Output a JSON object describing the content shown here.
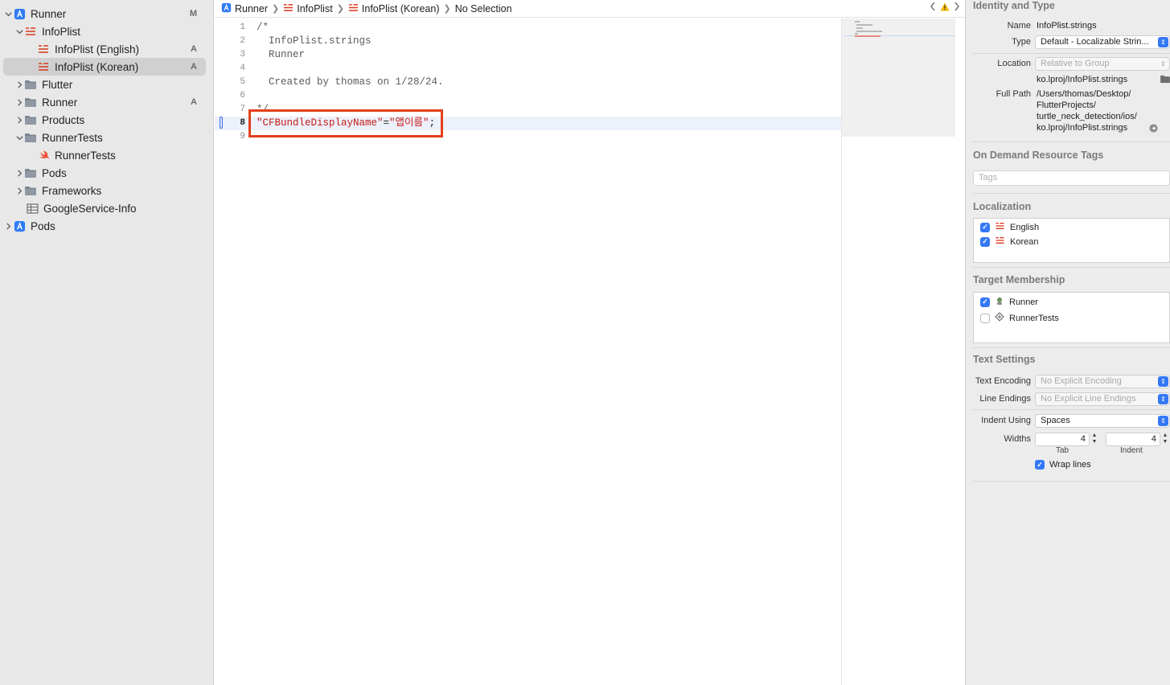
{
  "navigator": {
    "items": [
      {
        "label": "Runner",
        "badge": "M",
        "icon": "xcode-project-icon",
        "expanded": true
      },
      {
        "label": "InfoPlist",
        "badge": "",
        "icon": "strings-file-icon",
        "expanded": true
      },
      {
        "label": "InfoPlist (English)",
        "badge": "A",
        "icon": "strings-file-icon"
      },
      {
        "label": "InfoPlist (Korean)",
        "badge": "A",
        "icon": "strings-file-icon",
        "selected": true
      },
      {
        "label": "Flutter",
        "badge": "",
        "icon": "folder-icon",
        "expanded": false
      },
      {
        "label": "Runner",
        "badge": "A",
        "icon": "folder-icon",
        "expanded": false
      },
      {
        "label": "Products",
        "badge": "",
        "icon": "folder-icon",
        "expanded": false
      },
      {
        "label": "RunnerTests",
        "badge": "",
        "icon": "folder-icon",
        "expanded": true
      },
      {
        "label": "RunnerTests",
        "badge": "",
        "icon": "swift-file-icon"
      },
      {
        "label": "Pods",
        "badge": "",
        "icon": "folder-icon",
        "expanded": false
      },
      {
        "label": "Frameworks",
        "badge": "",
        "icon": "folder-icon",
        "expanded": false
      },
      {
        "label": "GoogleService-Info",
        "badge": "",
        "icon": "plist-file-icon"
      },
      {
        "label": "Pods",
        "badge": "",
        "icon": "xcode-project-icon",
        "expanded": false
      }
    ]
  },
  "jumpbar": {
    "crumbs": [
      "Runner",
      "InfoPlist",
      "InfoPlist (Korean)",
      "No Selection"
    ]
  },
  "editor": {
    "current_line": 8,
    "lines": [
      {
        "num": "1",
        "text": "/*"
      },
      {
        "num": "2",
        "text": "  InfoPlist.strings"
      },
      {
        "num": "3",
        "text": "  Runner"
      },
      {
        "num": "4",
        "text": ""
      },
      {
        "num": "5",
        "text": "  Created by thomas on 1/28/24."
      },
      {
        "num": "6",
        "text": ""
      },
      {
        "num": "7",
        "text": "*/"
      },
      {
        "num": "8",
        "key": "\"CFBundleDisplayName\"",
        "eq": "=",
        "value": "\"앱이름\"",
        "end": ";"
      },
      {
        "num": "9",
        "text": ""
      }
    ]
  },
  "inspector": {
    "identity": {
      "title": "Identity and Type",
      "name_label": "Name",
      "name_value": "InfoPlist.strings",
      "type_label": "Type",
      "type_value": "Default - Localizable Strin...",
      "location_label": "Location",
      "location_value": "Relative to Group",
      "location_path": "ko.lproj/InfoPlist.strings",
      "fullpath_label": "Full Path",
      "fullpath_lines": [
        "/Users/thomas/Desktop/",
        "FlutterProjects/",
        "turtle_neck_detection/ios/",
        "ko.lproj/InfoPlist.strings"
      ]
    },
    "odr": {
      "title": "On Demand Resource Tags",
      "placeholder": "Tags"
    },
    "localization": {
      "title": "Localization",
      "items": [
        {
          "label": "English",
          "checked": true
        },
        {
          "label": "Korean",
          "checked": true
        }
      ]
    },
    "target": {
      "title": "Target Membership",
      "items": [
        {
          "label": "Runner",
          "checked": true,
          "icon": "app-target-icon"
        },
        {
          "label": "RunnerTests",
          "checked": false,
          "icon": "test-target-icon"
        }
      ]
    },
    "text_settings": {
      "title": "Text Settings",
      "encoding_label": "Text Encoding",
      "encoding_value": "No Explicit Encoding",
      "endings_label": "Line Endings",
      "endings_value": "No Explicit Line Endings",
      "indent_label": "Indent Using",
      "indent_value": "Spaces",
      "widths_label": "Widths",
      "tab_value": "4",
      "indent_width_value": "4",
      "tab_sublabel": "Tab",
      "indent_sublabel": "Indent",
      "wrap_label": "Wrap lines",
      "wrap_checked": true
    }
  },
  "colors": {
    "accent": "#3478f6",
    "highlight_box": "#e2401c",
    "string": "#c41a16"
  }
}
